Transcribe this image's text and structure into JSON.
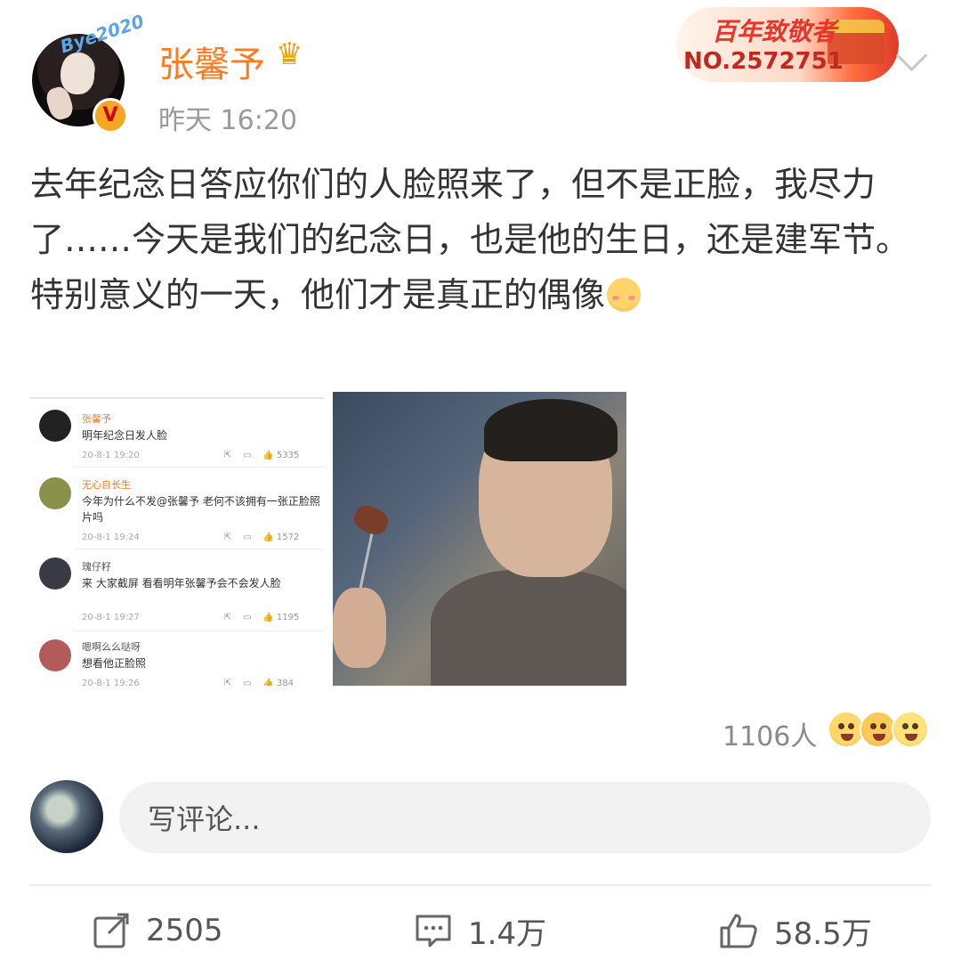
{
  "post": {
    "author": "张馨予",
    "avatar_deco_text": "Bye2020",
    "timestamp": "昨天 16:20",
    "badge": {
      "title": "百年致敬者",
      "number": "NO.2572751"
    },
    "text_lines": [
      "去年纪念日答应你们的人脸照来了，但不是正脸，我尽力了……今天是我们的纪念日，也是他的生日，还是建军节。",
      "特别意义的一天，他们才是真正的偶像"
    ],
    "reactions": {
      "count_label": "1106人",
      "emojis": [
        "surprised-emoji-icon",
        "laughing-emoji-icon",
        "grin-emoji-icon"
      ]
    }
  },
  "embedded_comments": [
    {
      "name": "张馨予",
      "text": "明年纪念日发人脸",
      "time": "20-8-1 19:20",
      "likes": "5335",
      "avatar_color": "#222222",
      "name_color": "#ff7a1f"
    },
    {
      "name": "无心自长生",
      "text": "今年为什么不发@张馨予 老何不该拥有一张正脸照片吗",
      "time": "20-8-1 19:24",
      "likes": "1572",
      "avatar_color": "#8a8f4a",
      "name_color": "#ff7a1f"
    },
    {
      "name": "瑰仔籽",
      "text": "来 大家截屏 看看明年张馨予会不会发人脸",
      "time": "20-8-1 19:27",
      "likes": "1195",
      "avatar_color": "#3a3a44",
      "name_color": "#555555"
    },
    {
      "name": "嗯啊么么哒呀",
      "text": "想看他正脸照",
      "time": "20-8-1 19:26",
      "likes": "384",
      "avatar_color": "#b35a5a",
      "name_color": "#555555"
    }
  ],
  "composer": {
    "placeholder": "写评论..."
  },
  "actions": {
    "share": "2505",
    "comment": "1.4万",
    "like": "58.5万"
  }
}
